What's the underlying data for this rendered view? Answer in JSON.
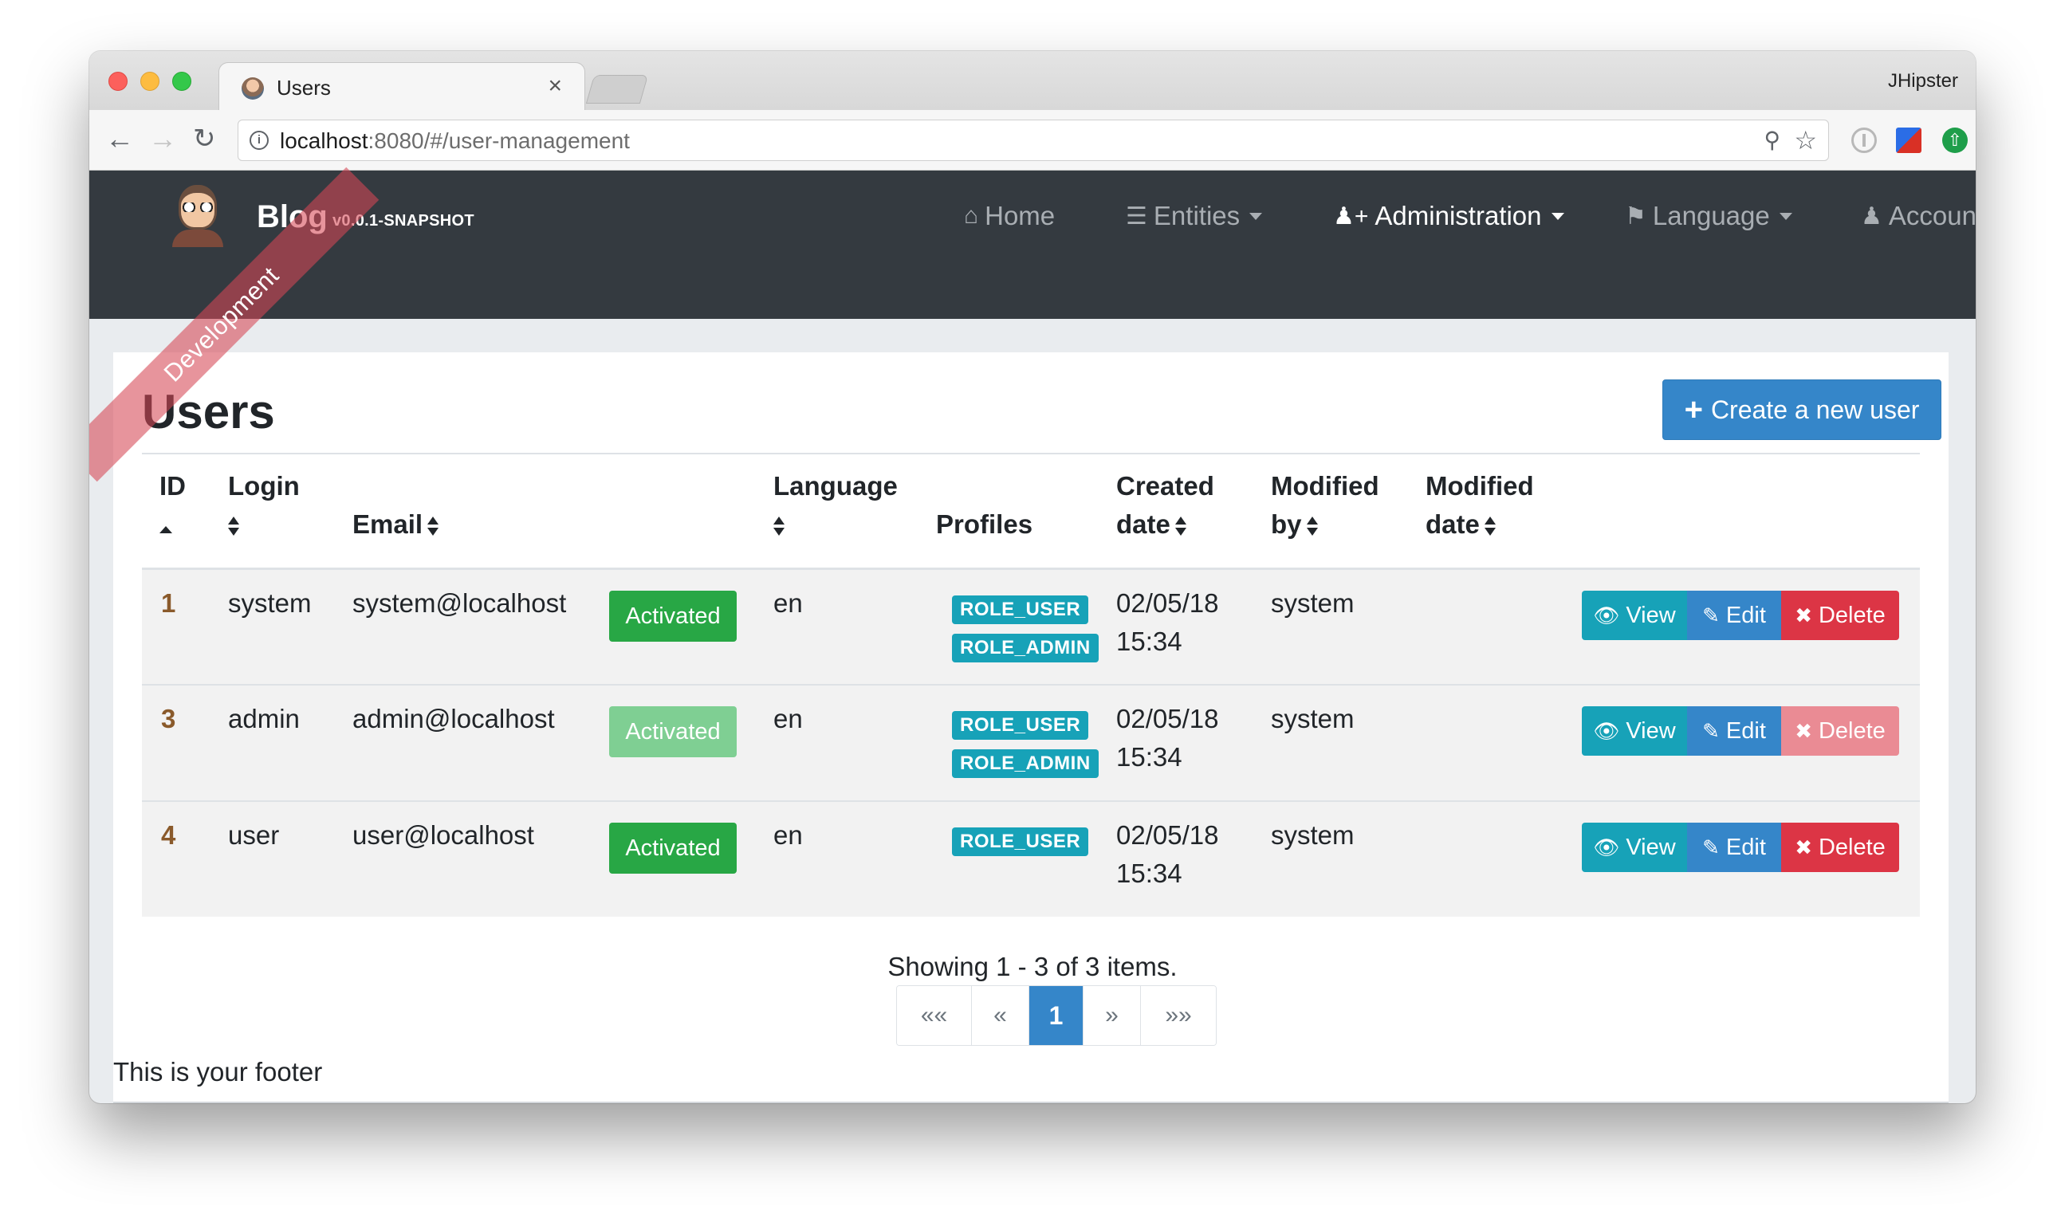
{
  "browser": {
    "tab_title": "Users",
    "tab_close": "×",
    "profile_name": "JHipster",
    "url_host": "localhost",
    "url_rest": ":8080/#/user-management"
  },
  "navbar": {
    "brand": "Blog",
    "version": "v0.0.1-SNAPSHOT",
    "ribbon": "Development",
    "menu": {
      "home": "Home",
      "entities": "Entities",
      "administration": "Administration",
      "language": "Language",
      "account": "Account"
    }
  },
  "page": {
    "title": "Users",
    "create_button": "Create a new user"
  },
  "table": {
    "headers": {
      "id": "ID",
      "login_1": "Login",
      "email": "Email",
      "language": "Language",
      "profiles": "Profiles",
      "created_1": "Created",
      "created_2": "date",
      "modby_1": "Modified",
      "modby_2": "by",
      "moddate_1": "Modified",
      "moddate_2": "date"
    },
    "rows": [
      {
        "id": "1",
        "login": "system",
        "email": "system@localhost",
        "status": "Activated",
        "lang": "en",
        "role_user": "ROLE_USER",
        "role_admin": "ROLE_ADMIN",
        "created_1": "02/05/18",
        "created_2": "15:34",
        "modified_by": "system"
      },
      {
        "id": "3",
        "login": "admin",
        "email": "admin@localhost",
        "status": "Activated",
        "lang": "en",
        "role_user": "ROLE_USER",
        "role_admin": "ROLE_ADMIN",
        "created_1": "02/05/18",
        "created_2": "15:34",
        "modified_by": "system"
      },
      {
        "id": "4",
        "login": "user",
        "email": "user@localhost",
        "status": "Activated",
        "lang": "en",
        "role_user": "ROLE_USER",
        "created_1": "02/05/18",
        "created_2": "15:34",
        "modified_by": "system"
      }
    ],
    "actions": {
      "view": "View",
      "edit": "Edit",
      "delete": "Delete"
    }
  },
  "pagination": {
    "summary": "Showing 1 - 3 of 3 items.",
    "first": "««",
    "prev": "«",
    "current": "1",
    "next": "»",
    "last": "»»"
  },
  "footer": {
    "text": "This is your footer"
  },
  "colors": {
    "navbar_bg": "#343a40",
    "primary": "#3586c9",
    "success": "#28a745",
    "info": "#17a2b8",
    "danger": "#dc3545"
  },
  "icons": [
    "home-icon",
    "list-icon",
    "user-plus-icon",
    "flag-icon",
    "user-icon",
    "eye-icon",
    "pencil-icon",
    "times-icon",
    "plus-icon",
    "sort-icon",
    "key-icon",
    "star-icon"
  ]
}
